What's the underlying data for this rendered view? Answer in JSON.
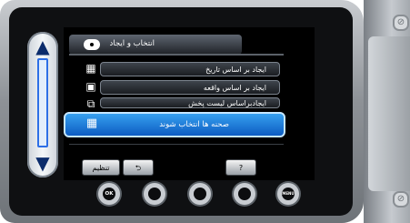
{
  "header": {
    "title": "انتخاب و ایجاد"
  },
  "menu": {
    "items": [
      {
        "label": "ایجاد بر اساس تاریخ",
        "icon": "calendar-icon"
      },
      {
        "label": "ایجاد بر اساس واقعه",
        "icon": "event-icon"
      },
      {
        "label": "ایجادبراساس لیست پخش",
        "icon": "playlist-icon"
      }
    ],
    "selected": {
      "label": "صحنه ها انتخاب شوند",
      "icon": "scene-grid-icon"
    }
  },
  "bottom": {
    "settings_label": "تنظیم",
    "back_label": "⮌",
    "help_label": "?"
  },
  "hardware": {
    "ok_label": "OK",
    "menu_label": "MENU"
  }
}
